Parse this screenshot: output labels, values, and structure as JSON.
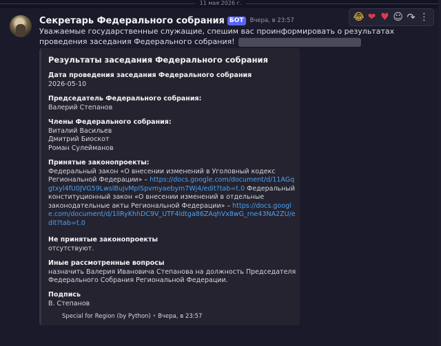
{
  "divider": {
    "date": "11 мая 2026 г."
  },
  "message": {
    "username": "Секретарь Федерального собрания",
    "bot_tag": "БОТ",
    "timestamp": "Вчера, в 23:57",
    "text": "Уважаемые государственные служащие, спешим вас проинформировать о результатах проведения заседания Федерального собрания!"
  },
  "toolbar": {
    "items": [
      {
        "icon": "laughing-emoji-icon",
        "glyph": "😂"
      },
      {
        "icon": "heart-emoji-icon",
        "glyph": "❤"
      },
      {
        "icon": "heart-emoji-icon",
        "glyph": "♥"
      },
      {
        "icon": "add-reaction-icon",
        "glyph": "☺"
      },
      {
        "icon": "reply-arrow-icon",
        "glyph": "↷"
      },
      {
        "icon": "more-icon",
        "glyph": "⋮"
      }
    ]
  },
  "embed": {
    "title": "Результаты заседания Федерального собрания",
    "fields": {
      "date": {
        "name": "Дата проведения заседания Федерального собрания",
        "value": "2026-05-10"
      },
      "chairman": {
        "name": "Председатель Федерального собрания:",
        "value": "Валерий Степанов"
      },
      "members": {
        "name": "Члены Федерального собрания:",
        "values": [
          "Виталий Васильев",
          "Дмитрий Биоскот",
          "Роман Сулейманов"
        ]
      },
      "adopted": {
        "name": "Принятые законопроекты:",
        "text1": "Федеральный закон «О внесении изменений в Уголовный кодекс Региональной Федерации» – ",
        "link1": "https://docs.google.com/document/d/11AGqgtxyl4fU0JVG59LwslBujvMplSpvmyaebym7Wj4/edit?tab=t.0",
        "text2": " Федеральный конституционный закон «О внесении изменений в отдельные законодательные акты Региональной Федерации» – ",
        "link2": "https://docs.google.com/document/d/1llRyKhhDC9V_UTF4ldtga86ZAqhVx8wG_rne43NA2ZU/edit?tab=t.0"
      },
      "rejected": {
        "name": "Не принятые законопроекты",
        "value": "отсутствуют."
      },
      "other": {
        "name": "Иные рассмотренные вопросы",
        "value": "назначить Валерия Ивановича Степанова на должность Председателя Федерального Собрания Региональной Федерации."
      },
      "signature": {
        "name": "Подпись",
        "value": "В. Степанов"
      }
    },
    "footer": {
      "text": "Special for Region (by Python)",
      "separator": "•",
      "time": "Вчера, в 23:57"
    }
  },
  "colors": {
    "background": "#141322",
    "message_bg": "#1b1a2b",
    "embed_bg": "#24232f",
    "link": "#4fa2f0",
    "bot_tag": "#5865f2"
  }
}
